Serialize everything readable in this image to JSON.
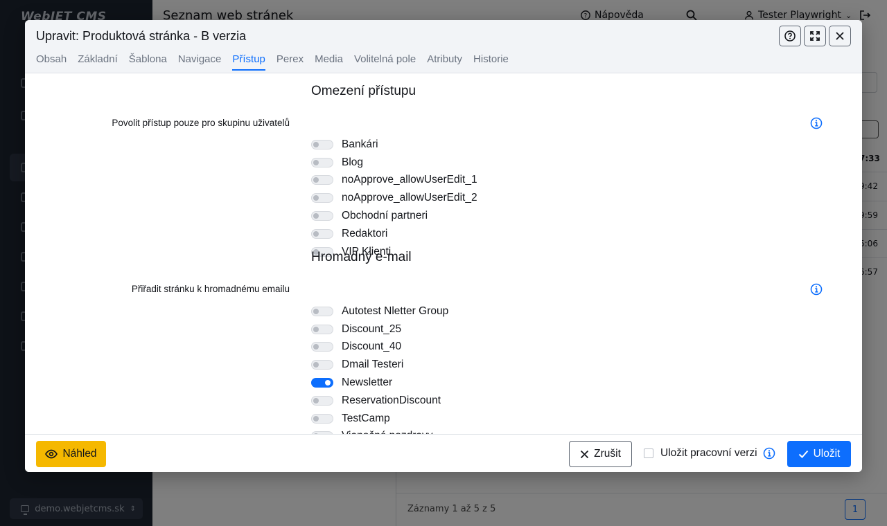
{
  "app": {
    "logo_text": "WebJET CMS",
    "page_title": "Seznam web stránek",
    "help_label": "Nápověda",
    "user_name": "Tester Playwright",
    "domain": "demo.webjetcms.sk",
    "bg_times": [
      "7:33",
      "9:42",
      "9:59",
      "5:06",
      "6:57"
    ],
    "records_info": "Záznamy 1 až 5 z 5",
    "current_page": "1"
  },
  "modal": {
    "title": "Upravit: Produktová stránka - B verzia",
    "tabs": [
      {
        "label": "Obsah"
      },
      {
        "label": "Základní"
      },
      {
        "label": "Šablona"
      },
      {
        "label": "Navigace"
      },
      {
        "label": "Přístup"
      },
      {
        "label": "Perex"
      },
      {
        "label": "Media"
      },
      {
        "label": "Volitelná pole"
      },
      {
        "label": "Atributy"
      },
      {
        "label": "Historie"
      }
    ],
    "active_tab": "Přístup",
    "access": {
      "section_title": "Omezení přístupu",
      "field_label": "Povolit přístup pouze pro skupinu uživatelů",
      "groups": [
        {
          "label": "Bankári",
          "on": false
        },
        {
          "label": "Blog",
          "on": false
        },
        {
          "label": "noApprove_allowUserEdit_1",
          "on": false
        },
        {
          "label": "noApprove_allowUserEdit_2",
          "on": false
        },
        {
          "label": "Obchodní partneri",
          "on": false
        },
        {
          "label": "Redaktori",
          "on": false
        },
        {
          "label": "VIP Klienti",
          "on": false
        }
      ]
    },
    "email": {
      "section_title": "Hromadný e-mail",
      "field_label": "Přiřadit stránku k hromadnému emailu",
      "groups": [
        {
          "label": "Autotest Nletter Group",
          "on": false
        },
        {
          "label": "Discount_25",
          "on": false
        },
        {
          "label": "Discount_40",
          "on": false
        },
        {
          "label": "Dmail Testeri",
          "on": false
        },
        {
          "label": "Newsletter",
          "on": true
        },
        {
          "label": "ReservationDiscount",
          "on": false
        },
        {
          "label": "TestCamp",
          "on": false
        },
        {
          "label": "Vianočné pozdravy",
          "on": false
        }
      ]
    },
    "footer": {
      "preview_label": "Náhled",
      "cancel_label": "Zrušit",
      "draft_label": "Uložit pracovní verzi",
      "draft_checked": false,
      "save_label": "Uložit"
    }
  },
  "colors": {
    "accent": "#0d6efd",
    "preview_button": "#f5b800",
    "sidebar": "#1d2430"
  }
}
